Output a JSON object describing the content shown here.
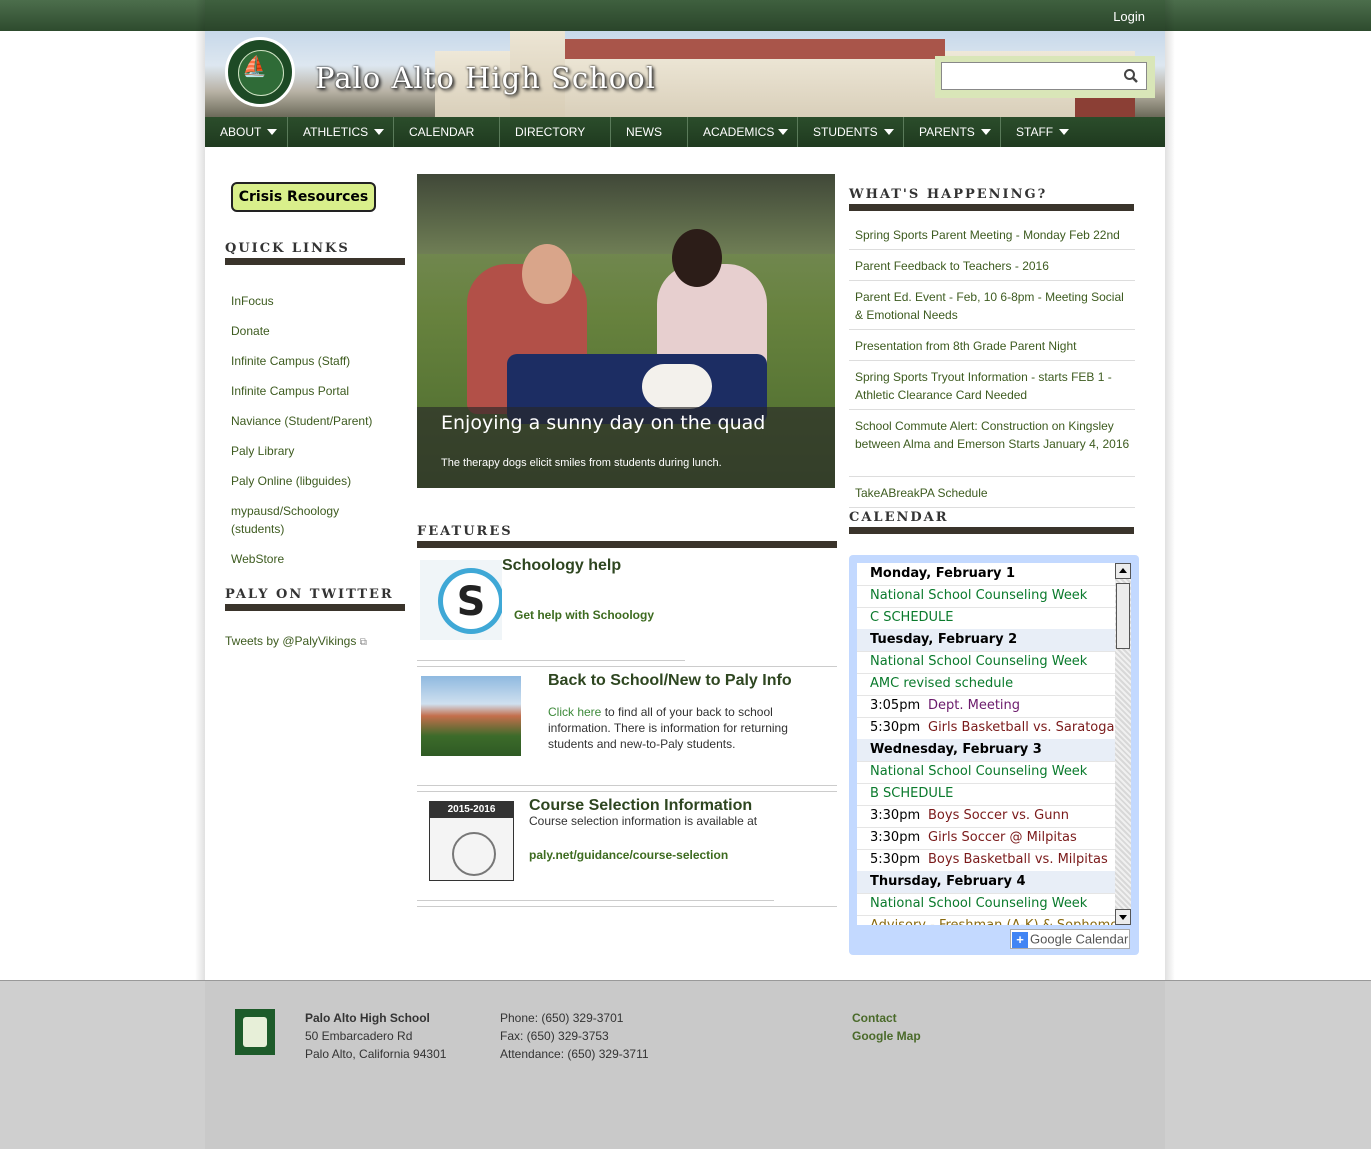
{
  "topbar": {
    "login_label": "Login"
  },
  "header": {
    "site_title": "Palo Alto High School",
    "search_placeholder": ""
  },
  "nav": {
    "items": [
      {
        "label": "ABOUT",
        "has_dropdown": true
      },
      {
        "label": "ATHLETICS",
        "has_dropdown": true
      },
      {
        "label": "CALENDAR",
        "has_dropdown": false
      },
      {
        "label": "DIRECTORY",
        "has_dropdown": false
      },
      {
        "label": "NEWS",
        "has_dropdown": false
      },
      {
        "label": "ACADEMICS",
        "has_dropdown": true
      },
      {
        "label": "STUDENTS",
        "has_dropdown": true
      },
      {
        "label": "PARENTS",
        "has_dropdown": true
      },
      {
        "label": "STAFF",
        "has_dropdown": true
      }
    ]
  },
  "sidebar": {
    "crisis_label": "Crisis Resources",
    "quick_links_title": "QUICK LINKS",
    "quick_links": [
      "InFocus",
      "Donate",
      "Infinite Campus (Staff)",
      "Infinite Campus Portal",
      "Naviance (Student/Parent)",
      "Paly Library",
      "Paly Online (libguides)",
      "mypausd/Schoology (students)",
      "WebStore"
    ],
    "twitter_title": "PALY ON TWITTER",
    "twitter_link": "Tweets by @PalyVikings"
  },
  "slideshow": {
    "title": "Enjoying a sunny day on the quad",
    "caption": "The therapy dogs elicit smiles from students during lunch."
  },
  "features": {
    "title": "FEATURES",
    "items": [
      {
        "title": "Schoology help",
        "link": "Get help with Schoology"
      },
      {
        "title": "Back to School/New to Paly Info",
        "link": "Click here",
        "text": "to find all of your back to school information. There is information for returning students and new-to-Paly students."
      },
      {
        "title": "Course Selection Information",
        "text": "Course selection information is available at",
        "link": "paly.net/guidance/course-selection",
        "thumb_label": "2015-2016"
      }
    ]
  },
  "whats_happening": {
    "title": "WHAT'S HAPPENING?",
    "items": [
      "Spring Sports Parent Meeting - Monday Feb 22nd",
      "Parent Feedback to Teachers - 2016",
      "Parent Ed. Event - Feb, 10 6-8pm - Meeting Social & Emotional Needs",
      "Presentation from 8th Grade Parent Night",
      "Spring Sports Tryout Information - starts FEB 1 - Athletic Clearance Card Needed",
      "School Commute Alert: Construction on Kingsley between Alma and Emerson Starts January 4, 2016",
      "TakeABreakPA Schedule"
    ]
  },
  "calendar": {
    "title": "CALENDAR",
    "rows": [
      {
        "kind": "day",
        "text": "Monday, February 1"
      },
      {
        "kind": "event",
        "text": "National School Counseling Week",
        "color": "#0a7a2c"
      },
      {
        "kind": "event",
        "text": "C SCHEDULE",
        "color": "#0a7a2c"
      },
      {
        "kind": "day",
        "text": "Tuesday, February 2"
      },
      {
        "kind": "event",
        "text": "National School Counseling Week",
        "color": "#0a7a2c"
      },
      {
        "kind": "event",
        "text": "AMC revised schedule",
        "color": "#0a7a2c"
      },
      {
        "kind": "timed",
        "time": "3:05pm",
        "text": "Dept. Meeting",
        "color": "#6b1a6b"
      },
      {
        "kind": "timed",
        "time": "5:30pm",
        "text": "Girls Basketball vs. Saratoga",
        "color": "#7a1a1a"
      },
      {
        "kind": "day",
        "text": "Wednesday, February 3"
      },
      {
        "kind": "event",
        "text": "National School Counseling Week",
        "color": "#0a7a2c"
      },
      {
        "kind": "event",
        "text": "B SCHEDULE",
        "color": "#0a7a2c"
      },
      {
        "kind": "timed",
        "time": "3:30pm",
        "text": "Boys Soccer vs. Gunn",
        "color": "#7a1a1a"
      },
      {
        "kind": "timed",
        "time": "3:30pm",
        "text": "Girls Soccer @ Milpitas",
        "color": "#7a1a1a"
      },
      {
        "kind": "timed",
        "time": "5:30pm",
        "text": "Boys Basketball vs. Milpitas",
        "color": "#7a1a1a"
      },
      {
        "kind": "day",
        "text": "Thursday, February 4"
      },
      {
        "kind": "event",
        "text": "National School Counseling Week",
        "color": "#0a7a2c"
      },
      {
        "kind": "event",
        "text": "Advisory - Freshman (A-K) & Sophomore",
        "color": "#8a6a10"
      }
    ],
    "badge_label": "Google Calendar"
  },
  "footer": {
    "school_name": "Palo Alto High School",
    "address1": "50 Embarcadero Rd",
    "address2": "Palo Alto, California 94301",
    "phone": "Phone: (650) 329-3701",
    "fax": "Fax: (650) 329-3753",
    "attendance": "Attendance: (650) 329-3711",
    "links": [
      "Contact",
      "Google Map"
    ]
  }
}
